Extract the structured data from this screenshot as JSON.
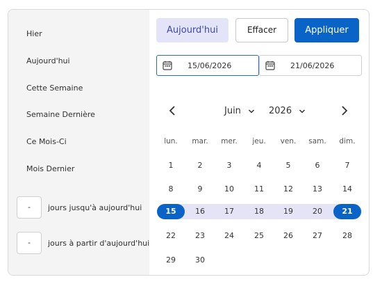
{
  "sidebar": {
    "presets": [
      "Hier",
      "Aujourd'hui",
      "Cette Semaine",
      "Semaine Dernière",
      "Ce Mois-Ci",
      "Mois Dernier"
    ],
    "days_until": {
      "value": "-",
      "label": "jours jusqu'à aujourd'hui"
    },
    "days_from": {
      "value": "-",
      "label": "jours à partir d'aujourd'hui"
    }
  },
  "actions": {
    "today_label": "Aujourd'hui",
    "clear_label": "Effacer",
    "apply_label": "Appliquer"
  },
  "range": {
    "start": "15/06/2026",
    "end": "21/06/2026"
  },
  "calendar": {
    "month": "Juin",
    "year": "2026",
    "weekdays": [
      "lun.",
      "mar.",
      "mer.",
      "jeu.",
      "ven.",
      "sam.",
      "dim."
    ],
    "weeks": [
      [
        "1",
        "2",
        "3",
        "4",
        "5",
        "6",
        "7"
      ],
      [
        "8",
        "9",
        "10",
        "11",
        "12",
        "13",
        "14"
      ],
      [
        "15",
        "16",
        "17",
        "18",
        "19",
        "20",
        "21"
      ],
      [
        "22",
        "23",
        "24",
        "25",
        "26",
        "27",
        "28"
      ],
      [
        "29",
        "30",
        "",
        "",
        "",
        "",
        ""
      ]
    ],
    "selected_start_day": "15",
    "selected_end_day": "21"
  },
  "colors": {
    "accent": "#0a63c6",
    "range_fill": "#e4e4f6",
    "today_button_bg": "#e3e4f8"
  },
  "icons": {
    "date_field": "calendar-icon",
    "prev": "chevron-left-icon",
    "next": "chevron-right-icon",
    "dropdown": "chevron-down-icon"
  }
}
